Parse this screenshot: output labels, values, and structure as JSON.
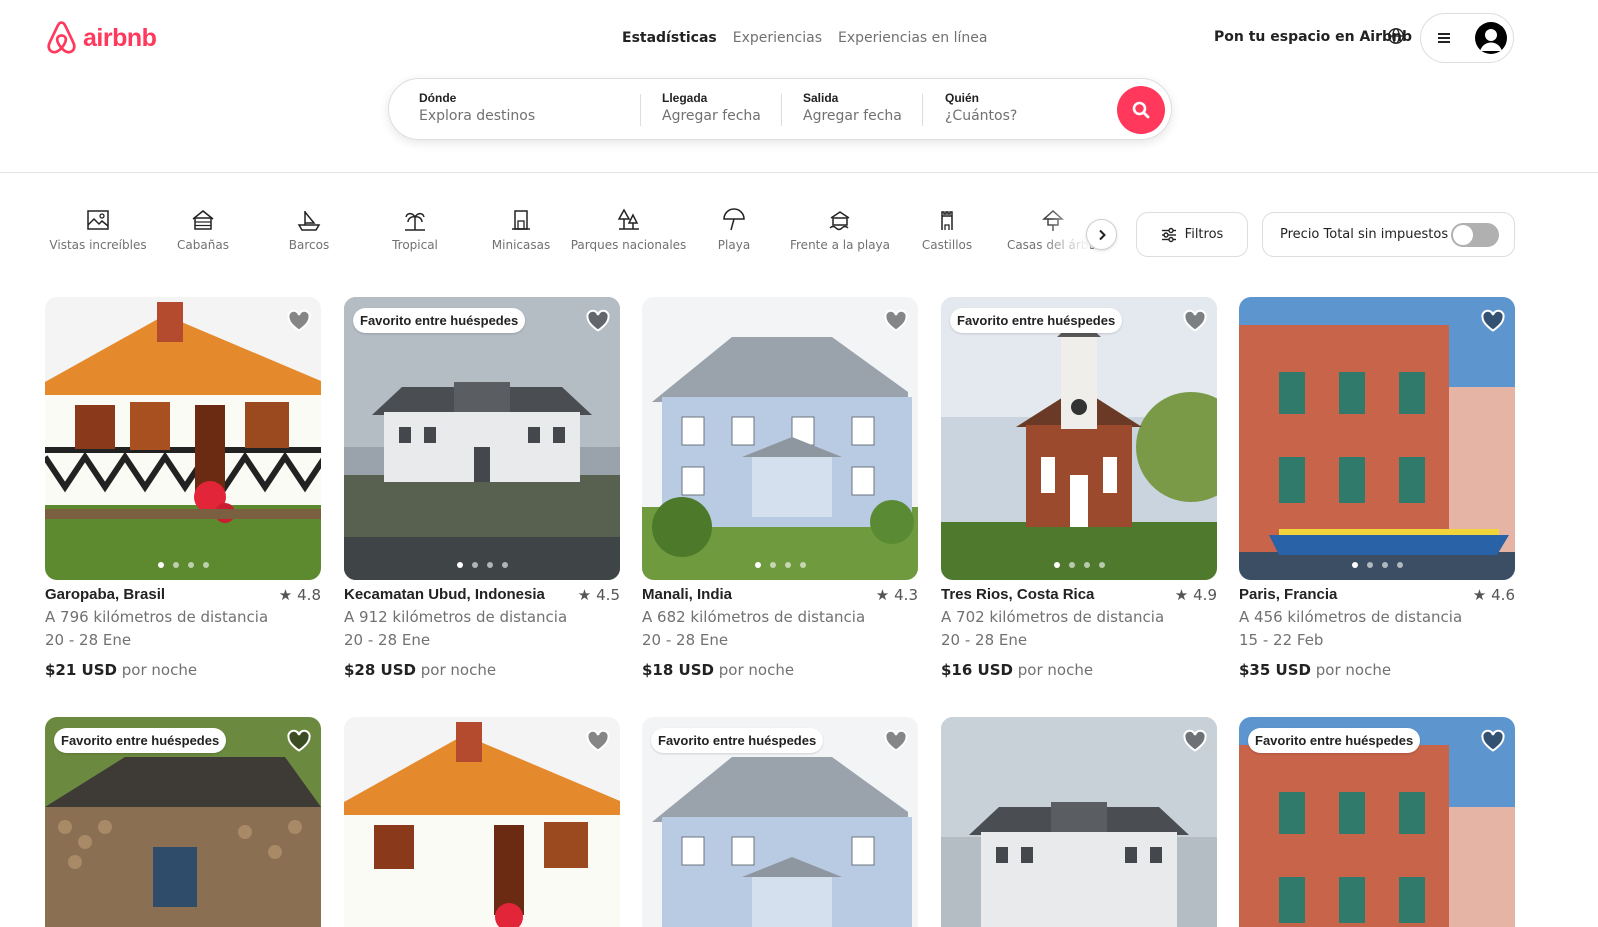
{
  "brand": {
    "name": "airbnb",
    "color": "#ff385c"
  },
  "nav": [
    "Estadísticas",
    "Experiencias",
    "Experiencias en línea"
  ],
  "header": {
    "host_link": "Pon tu espacio en Airbnb"
  },
  "search": {
    "where_label": "Dónde",
    "where_placeholder": "Explora destinos",
    "checkin_label": "Llegada",
    "checkin_placeholder": "Agregar fecha",
    "checkout_label": "Salida",
    "checkout_placeholder": "Agregar fecha",
    "who_label": "Quién",
    "who_placeholder": "¿Cuántos?"
  },
  "categories": [
    {
      "label": "Vistas increíbles",
      "icon": "amazing-views-icon"
    },
    {
      "label": "Cabañas",
      "icon": "cabin-icon"
    },
    {
      "label": "Barcos",
      "icon": "boat-icon"
    },
    {
      "label": "Tropical",
      "icon": "tropical-icon"
    },
    {
      "label": "Minicasas",
      "icon": "tiny-home-icon"
    },
    {
      "label": "Parques nacionales",
      "icon": "national-park-icon"
    },
    {
      "label": "Playa",
      "icon": "beach-umbrella-icon"
    },
    {
      "label": "Frente a la playa",
      "icon": "beachfront-icon"
    },
    {
      "label": "Castillos",
      "icon": "castle-icon"
    },
    {
      "label": "Casas del árbol",
      "icon": "treehouse-icon"
    }
  ],
  "filters": {
    "filter_label": "Filtros",
    "price_toggle_label": "Precio Total sin impuestos",
    "price_toggle_on": false
  },
  "listings": [
    {
      "location": "Garopaba, Brasil",
      "rating": "4.8",
      "distance": "A 796 kilómetros de distancia",
      "dates": "20 - 28 Ene",
      "price": "$21 USD",
      "per": "por noche",
      "badge": ""
    },
    {
      "location": "Kecamatan Ubud, Indonesia",
      "rating": "4.5",
      "distance": "A 912 kilómetros de distancia",
      "dates": "20 - 28 Ene",
      "price": "$28 USD",
      "per": "por noche",
      "badge": "Favorito entre huéspedes"
    },
    {
      "location": "Manali, India",
      "rating": "4.3",
      "distance": "A 682 kilómetros de distancia",
      "dates": "20 - 28 Ene",
      "price": "$18 USD",
      "per": "por noche",
      "badge": ""
    },
    {
      "location": "Tres Rios, Costa Rica",
      "rating": "4.9",
      "distance": "A 702 kilómetros de distancia",
      "dates": "20 - 28 Ene",
      "price": "$16 USD",
      "per": "por noche",
      "badge": "Favorito entre huéspedes"
    },
    {
      "location": "Paris, Francia",
      "rating": "4.6",
      "distance": "A 456 kilómetros de distancia",
      "dates": "15 - 22 Feb",
      "price": "$35 USD",
      "per": "por noche",
      "badge": ""
    }
  ],
  "listings_row2": [
    {
      "badge": "Favorito entre huéspedes"
    },
    {
      "badge": ""
    },
    {
      "badge": "Favorito entre huéspedes"
    },
    {
      "badge": ""
    },
    {
      "badge": "Favorito entre huéspedes"
    }
  ]
}
